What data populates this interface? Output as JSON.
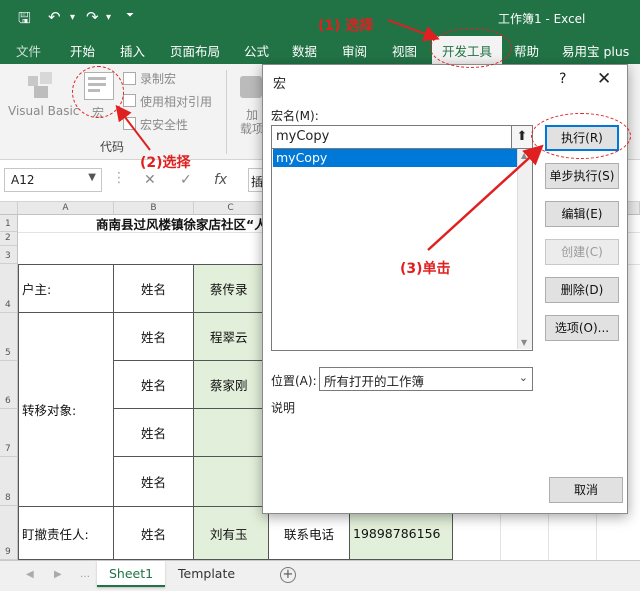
{
  "title_bar": {
    "title": "工作簿1 - Excel",
    "save_icon": "save-icon",
    "undo_icon": "undo-icon",
    "redo_icon": "redo-icon",
    "customize_icon": "customize-icon"
  },
  "ribbon_tabs": [
    "文件",
    "开始",
    "插入",
    "页面布局",
    "公式",
    "数据",
    "审阅",
    "视图",
    "开发工具",
    "帮助",
    "易用宝 plus"
  ],
  "ribbon": {
    "visual_basic": "Visual Basic",
    "macros": "宏",
    "record_macro": "录制宏",
    "relative_ref": "使用相对引用",
    "macro_security": "宏安全性",
    "group_label": "代码",
    "addins_1": "加",
    "addins_2": "载项"
  },
  "formula_bar": {
    "name_box": "A12",
    "fx": "fx",
    "content": "插"
  },
  "grid": {
    "columns": [
      "A",
      "B",
      "C"
    ],
    "rows": [
      "1",
      "2",
      "3",
      "4",
      "5",
      "6",
      "7",
      "8",
      "9"
    ],
    "title": "商南县过风楼镇徐家店社区“人",
    "household_head": "户主:",
    "name_label": "姓名",
    "head_name": "蔡传录",
    "transfer_label": "转移对象:",
    "transfer_1": "程翠云",
    "transfer_2": "蔡家刚",
    "responsible_label": "盯撤责任人:",
    "responsible_name": "刘有玉",
    "phone_label": "联系电话",
    "phone": "19898786156"
  },
  "sheet_tabs": [
    "Sheet1",
    "Template"
  ],
  "dialog": {
    "title": "宏",
    "help": "?",
    "close": "✕",
    "macro_name_label": "宏名(M):",
    "macro_name_value": "myCopy",
    "macro_list": [
      "myCopy"
    ],
    "buttons": {
      "run": "执行(R)",
      "step": "单步执行(S)",
      "edit": "编辑(E)",
      "create": "创建(C)",
      "delete": "删除(D)",
      "options": "选项(O)..."
    },
    "location_label": "位置(A):",
    "location_value": "所有打开的工作簿",
    "description_label": "说明",
    "cancel": "取消"
  },
  "annotations": {
    "step1": "(1) 选择",
    "step2": "(2)选择",
    "step3": "(3)单击"
  },
  "colors": {
    "excel_green": "#217346",
    "annotation_red": "#e02020",
    "selection_blue": "#0078d7",
    "cell_green": "#e2efda"
  }
}
